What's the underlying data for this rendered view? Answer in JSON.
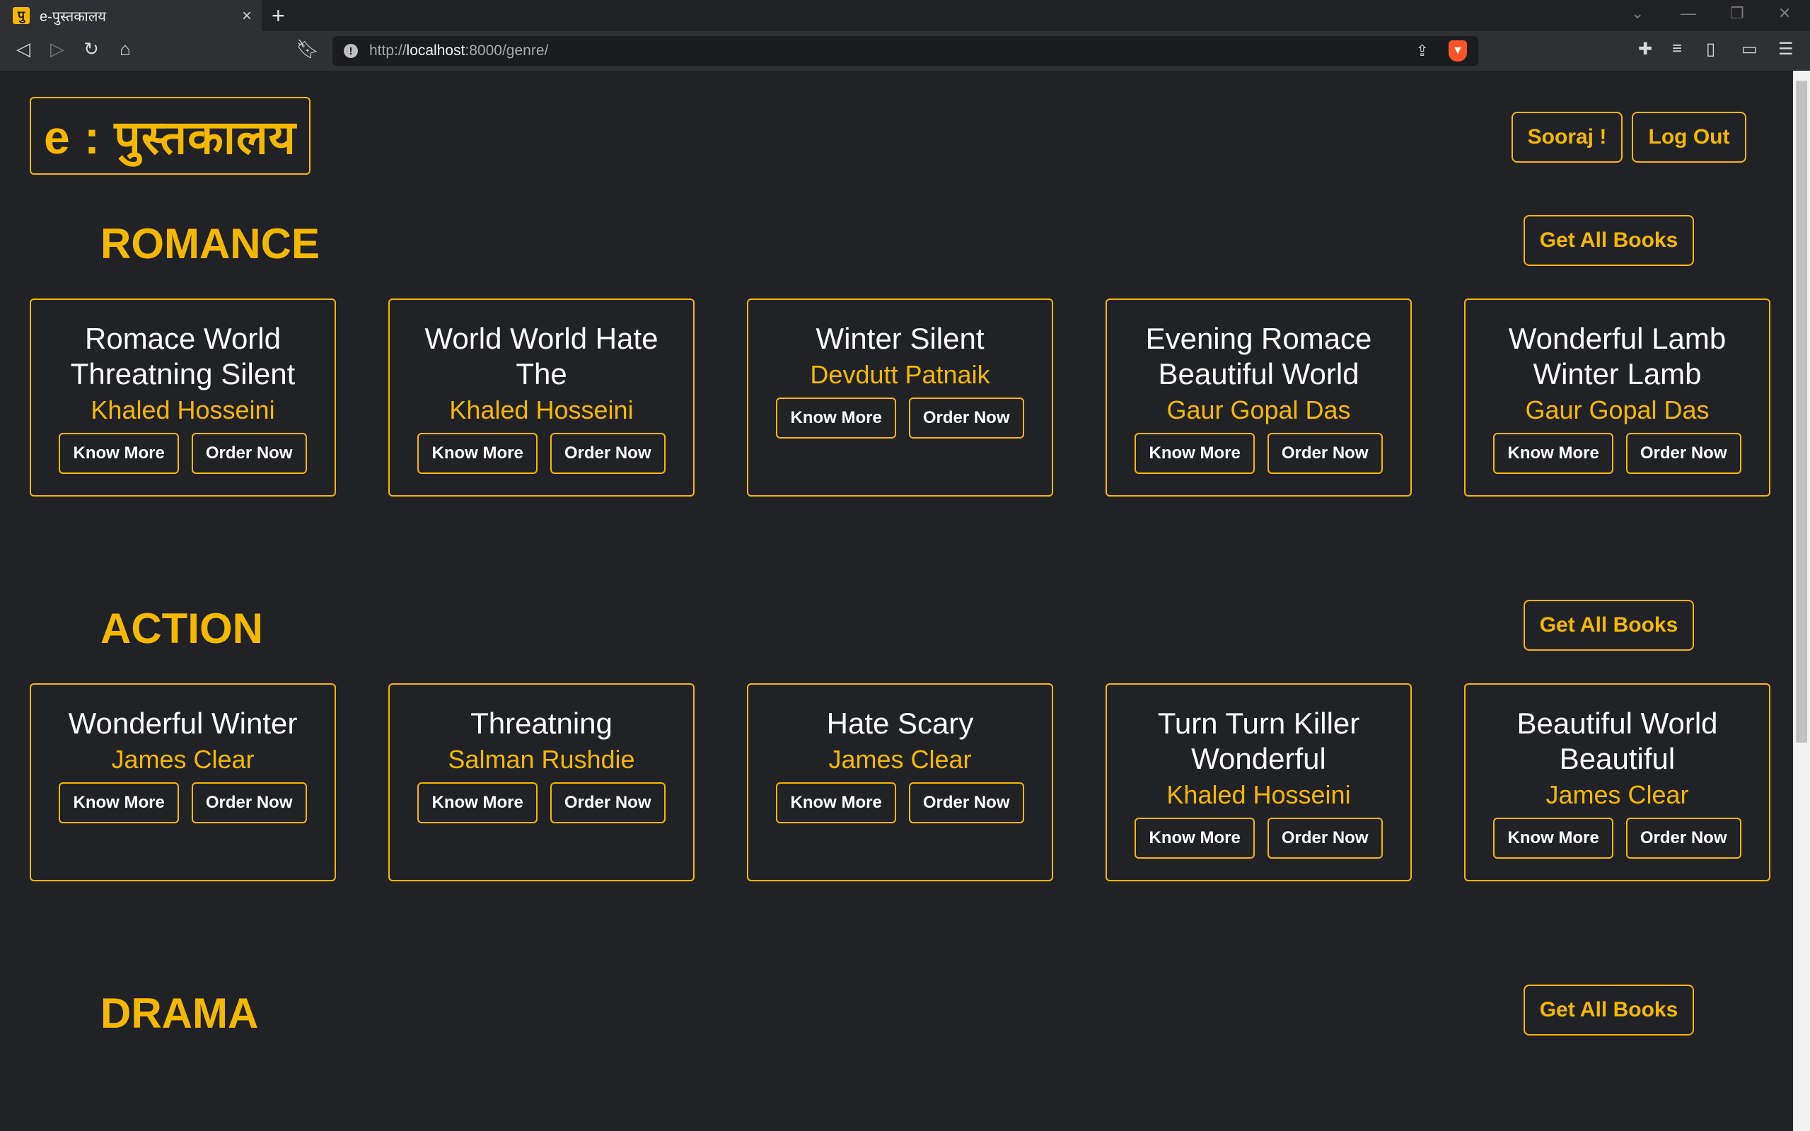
{
  "browser": {
    "tab_title": "e-पुस्तकालय",
    "favicon_letter": "पु",
    "url_prefix": "http://",
    "url_host": "localhost",
    "url_rest": ":8000/genre/"
  },
  "header": {
    "brand": "e : पुस्तकालय",
    "user_button": "Sooraj !",
    "logout_button": "Log Out"
  },
  "sections": [
    {
      "title": "ROMANCE",
      "get_all": "Get All Books",
      "books": [
        {
          "title": "Romace World Threatning Silent",
          "author": "Khaled Hosseini"
        },
        {
          "title": "World World Hate The",
          "author": "Khaled Hosseini"
        },
        {
          "title": "Winter Silent",
          "author": "Devdutt Patnaik"
        },
        {
          "title": "Evening Romace Beautiful World",
          "author": "Gaur Gopal Das"
        },
        {
          "title": "Wonderful Lamb Winter Lamb",
          "author": "Gaur Gopal Das"
        }
      ]
    },
    {
      "title": "ACTION",
      "get_all": "Get All Books",
      "books": [
        {
          "title": "Wonderful Winter",
          "author": "James Clear"
        },
        {
          "title": "Threatning",
          "author": "Salman Rushdie"
        },
        {
          "title": "Hate Scary",
          "author": "James Clear"
        },
        {
          "title": "Turn Turn Killer Wonderful",
          "author": "Khaled Hosseini"
        },
        {
          "title": "Beautiful World Beautiful",
          "author": "James Clear"
        }
      ]
    },
    {
      "title": "DRAMA",
      "get_all": "Get All Books",
      "books": []
    }
  ],
  "card_buttons": {
    "know_more": "Know More",
    "order_now": "Order Now"
  }
}
